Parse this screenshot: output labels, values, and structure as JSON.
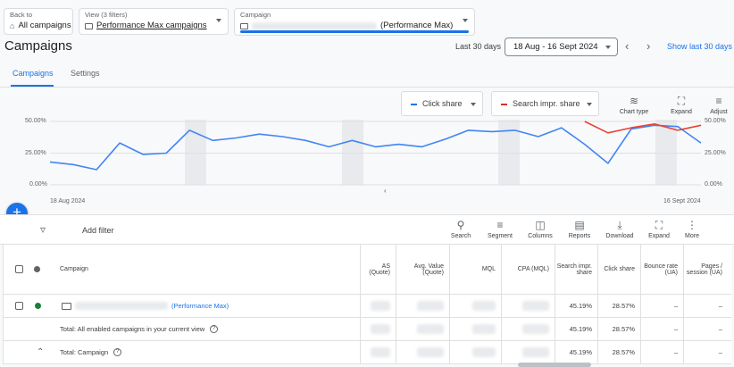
{
  "header": {
    "back": {
      "caption": "Back to",
      "label": "All campaigns"
    },
    "view": {
      "caption": "View (3 filters)",
      "label": "Performance Max campaigns"
    },
    "campaign": {
      "caption": "Campaign",
      "label": "(Performance Max)"
    }
  },
  "page_title": "Campaigns",
  "date": {
    "range_label": "Last 30 days",
    "range_value": "18 Aug - 16 Sept 2024",
    "show_last": "Show last 30 days"
  },
  "tabs": [
    {
      "label": "Campaigns",
      "active": true
    },
    {
      "label": "Settings",
      "active": false
    }
  ],
  "chart_controls": {
    "metric1": {
      "label": "Click share",
      "color": "#1a73e8"
    },
    "metric2": {
      "label": "Search impr. share",
      "color": "#d93025"
    },
    "chart_type": "Chart type",
    "expand": "Expand",
    "adjust": "Adjust"
  },
  "chart_data": {
    "type": "line",
    "x_start_label": "18 Aug 2024",
    "x_end_label": "16 Sept 2024",
    "y_ticks_left": [
      "50.00%",
      "25.00%",
      "0.00%"
    ],
    "y_ticks_right": [
      "50.00%",
      "25.00%",
      "0.00%"
    ],
    "ylim": [
      0,
      57
    ],
    "series": [
      {
        "name": "Click share",
        "color": "#4285f4",
        "values": [
          18,
          16,
          12,
          33,
          24,
          25,
          43,
          35,
          37,
          40,
          38,
          35,
          30,
          35,
          30,
          32,
          30,
          36,
          43,
          42,
          43,
          38,
          45,
          32,
          17,
          44,
          47,
          46,
          33
        ]
      },
      {
        "name": "Search impr. share",
        "color": "#ea4335",
        "values": [
          null,
          null,
          null,
          null,
          null,
          null,
          null,
          null,
          null,
          null,
          null,
          null,
          null,
          null,
          null,
          null,
          null,
          null,
          null,
          null,
          null,
          null,
          null,
          50,
          41,
          45,
          48,
          43,
          47
        ]
      }
    ]
  },
  "toolbar": {
    "add_filter": "Add filter",
    "tools": [
      "Search",
      "Segment",
      "Columns",
      "Reports",
      "Download",
      "Expand",
      "More"
    ]
  },
  "table": {
    "headers": [
      "Campaign",
      "AS (Quote)",
      "Avg. Value (Quote)",
      "MQL",
      "CPA (MQL)",
      "Search impr. share",
      "Click share",
      "Bounce rate (UA)",
      "Pages / session (UA)"
    ],
    "rows": [
      {
        "name": "(Performance Max)",
        "search_impr_share": "45.19%",
        "click_share": "28.57%",
        "bounce": "–",
        "pages": "–"
      }
    ],
    "total_enabled": {
      "label": "Total: All enabled campaigns in your current view",
      "search_impr_share": "45.19%",
      "click_share": "28.57%",
      "bounce": "–",
      "pages": "–"
    },
    "total_campaign": {
      "label": "Total: Campaign",
      "search_impr_share": "45.19%",
      "click_share": "28.57%",
      "bounce": "–",
      "pages": "–"
    }
  }
}
